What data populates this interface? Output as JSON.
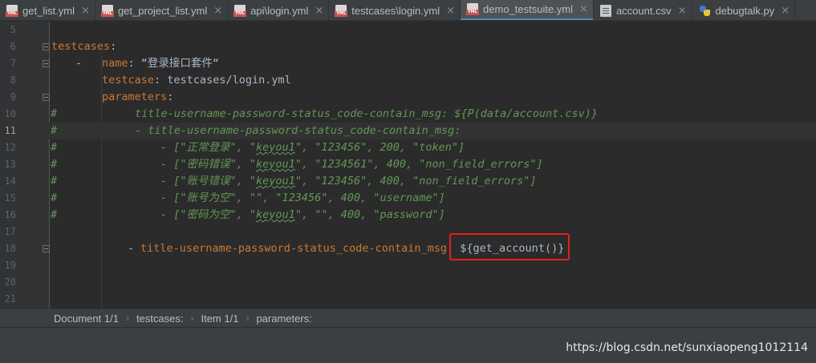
{
  "tabs": [
    {
      "label": "get_list.yml",
      "icon": "yml-file-icon",
      "active": false
    },
    {
      "label": "get_project_list.yml",
      "icon": "yml-file-icon",
      "active": false
    },
    {
      "label": "api\\login.yml",
      "icon": "yml-file-icon",
      "active": false
    },
    {
      "label": "testcases\\login.yml",
      "icon": "yml-file-icon",
      "active": false
    },
    {
      "label": "demo_testsuite.yml",
      "icon": "yml-file-icon",
      "active": true
    },
    {
      "label": "account.csv",
      "icon": "csv-file-icon",
      "active": false
    },
    {
      "label": "debugtalk.py",
      "icon": "python-file-icon",
      "active": false
    }
  ],
  "close_glyph": "×",
  "editor": {
    "current_line": 11,
    "lines": [
      {
        "n": "5"
      },
      {
        "n": "6",
        "key": "testcases",
        "colon": ":"
      },
      {
        "n": "7",
        "dash": "-",
        "key": "name",
        "colon": ": ",
        "value": "“登录接口套件“"
      },
      {
        "n": "8",
        "key": "testcase",
        "colon": ": ",
        "value": "testcases/login.yml"
      },
      {
        "n": "9",
        "key": "parameters",
        "colon": ":"
      },
      {
        "n": "10",
        "hash": "#",
        "comment": "title-username-password-status_code-contain_msg: ${P(data/account.csv)}"
      },
      {
        "n": "11",
        "hash": "#",
        "comment": "- title-username-password-status_code-contain_msg:"
      },
      {
        "n": "12",
        "hash": "#",
        "pre": "- [\"正常登录\", \"",
        "wavy": "keyou1",
        "post": "\", \"123456\", 200, \"token\"]"
      },
      {
        "n": "13",
        "hash": "#",
        "pre": "- [\"密码错误\", \"",
        "wavy": "keyou1",
        "post": "\", \"1234561\", 400, \"non_field_errors\"]"
      },
      {
        "n": "14",
        "hash": "#",
        "pre": "- [\"账号错误\", \"",
        "wavy": "keyou1",
        "post": "\", \"123456\", 400, \"non_field_errors\"]"
      },
      {
        "n": "15",
        "hash": "#",
        "comment": "- [\"账号为空\", \"\", \"123456\", 400, \"username\"]"
      },
      {
        "n": "16",
        "hash": "#",
        "pre": "- [\"密码为空\", \"",
        "wavy": "keyou1",
        "post": "\", \"\", 400, \"password\"]"
      },
      {
        "n": "17"
      },
      {
        "n": "18",
        "dash": "-",
        "key": "title-username-password-status_code-contain_msg",
        "colon": ": ",
        "value": "${get_account()}"
      },
      {
        "n": "19"
      },
      {
        "n": "20"
      },
      {
        "n": "21"
      }
    ]
  },
  "breadcrumb": [
    "Document 1/1",
    "testcases:",
    "Item 1/1",
    "parameters:"
  ],
  "breadcrumb_sep": "›",
  "watermark": "https://blog.csdn.net/sunxiaopeng1012114",
  "colors": {
    "key": "#cc7832",
    "string": "#6a8759",
    "comment": "#629755",
    "highlight_box": "#e3201b",
    "active_tab_underline": "#4a88c7"
  }
}
